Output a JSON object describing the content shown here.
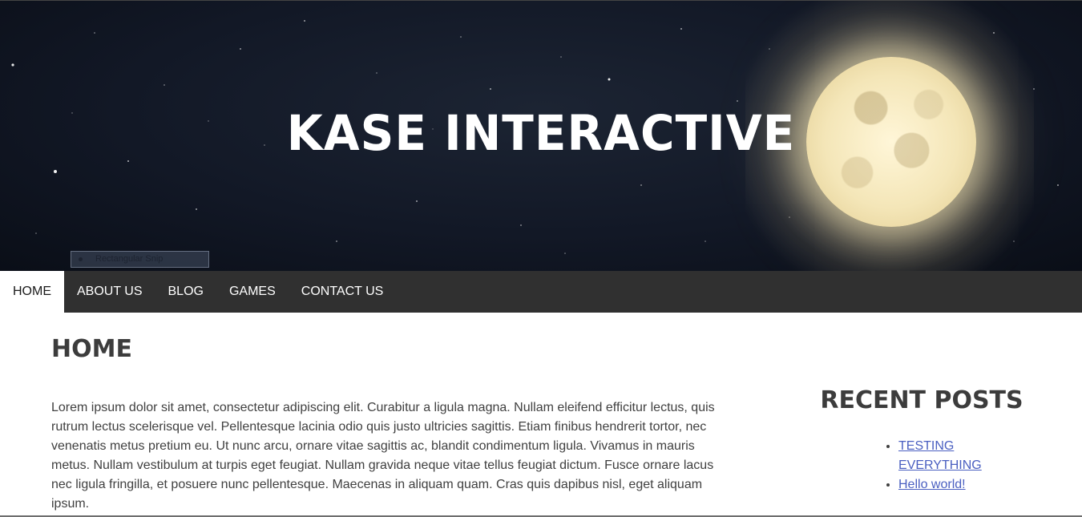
{
  "header": {
    "site_title": "Kase Interactive",
    "tooltip": "Rectangular Snip"
  },
  "nav": {
    "items": [
      {
        "label": "HOME",
        "active": true
      },
      {
        "label": "ABOUT US",
        "active": false
      },
      {
        "label": "BLOG",
        "active": false
      },
      {
        "label": "GAMES",
        "active": false
      },
      {
        "label": "CONTACT US",
        "active": false
      }
    ]
  },
  "main": {
    "title": "Home",
    "body": "Lorem ipsum dolor sit amet, consectetur adipiscing elit. Curabitur a ligula magna. Nullam eleifend efficitur lectus, quis rutrum lectus scelerisque vel. Pellentesque lacinia odio quis justo ultricies sagittis. Etiam finibus hendrerit tortor, nec venenatis metus pretium eu. Ut nunc arcu, ornare vitae sagittis ac, blandit condimentum ligula. Vivamus in mauris metus. Nullam vestibulum at turpis eget feugiat. Nullam gravida neque vitae tellus feugiat dictum. Fusce ornare lacus nec ligula fringilla, et posuere nunc pellentesque. Maecenas in aliquam quam. Cras quis dapibus nisl, eget aliquam ipsum."
  },
  "sidebar": {
    "title": "Recent Posts",
    "posts": [
      {
        "label": "TESTING EVERYTHING"
      },
      {
        "label": "Hello world!"
      }
    ]
  },
  "colors": {
    "nav_background": "#303030",
    "link": "#4a5fc1",
    "heading": "#3c3c3c"
  }
}
